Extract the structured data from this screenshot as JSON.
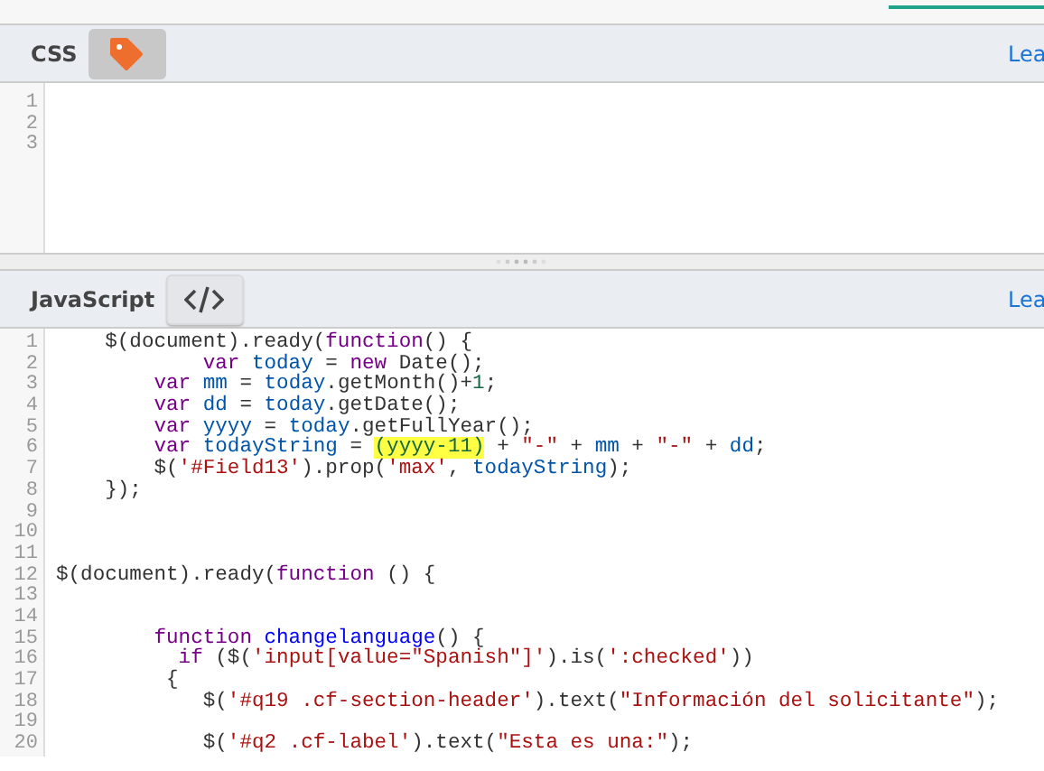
{
  "css_panel": {
    "title": "CSS",
    "link": "Lea",
    "line_numbers": [
      "1",
      "2",
      "3"
    ]
  },
  "js_panel": {
    "title": "JavaScript",
    "link": "Lea",
    "lines": [
      {
        "number": "1",
        "tokens": [
          {
            "kind": "plain",
            "text": "    $(document).ready("
          },
          {
            "kind": "keyword",
            "text": "function"
          },
          {
            "kind": "plain",
            "text": "() {"
          }
        ]
      },
      {
        "number": "2",
        "tokens": [
          {
            "kind": "keyword",
            "text": "            var "
          },
          {
            "kind": "variable",
            "text": "today"
          },
          {
            "kind": "plain",
            "text": " = "
          },
          {
            "kind": "keyword",
            "text": "new"
          },
          {
            "kind": "plain",
            "text": " Date();"
          }
        ]
      },
      {
        "number": "3",
        "tokens": [
          {
            "kind": "keyword",
            "text": "        var "
          },
          {
            "kind": "variable",
            "text": "mm"
          },
          {
            "kind": "plain",
            "text": " = "
          },
          {
            "kind": "variable",
            "text": "today"
          },
          {
            "kind": "plain",
            "text": ".getMonth()+"
          },
          {
            "kind": "number",
            "text": "1"
          },
          {
            "kind": "plain",
            "text": ";"
          }
        ]
      },
      {
        "number": "4",
        "tokens": [
          {
            "kind": "keyword",
            "text": "        var "
          },
          {
            "kind": "variable",
            "text": "dd"
          },
          {
            "kind": "plain",
            "text": " = "
          },
          {
            "kind": "variable",
            "text": "today"
          },
          {
            "kind": "plain",
            "text": ".getDate();"
          }
        ]
      },
      {
        "number": "5",
        "tokens": [
          {
            "kind": "keyword",
            "text": "        var "
          },
          {
            "kind": "variable",
            "text": "yyyy"
          },
          {
            "kind": "plain",
            "text": " = "
          },
          {
            "kind": "variable",
            "text": "today"
          },
          {
            "kind": "plain",
            "text": ".getFullYear();"
          }
        ]
      },
      {
        "number": "6",
        "tokens": [
          {
            "kind": "keyword",
            "text": "        var "
          },
          {
            "kind": "variable",
            "text": "todayString"
          },
          {
            "kind": "plain",
            "text": " = "
          },
          {
            "kind": "highlight",
            "text": "(yyyy-11)"
          },
          {
            "kind": "plain",
            "text": " + "
          },
          {
            "kind": "string",
            "text": "\"-\""
          },
          {
            "kind": "plain",
            "text": " + "
          },
          {
            "kind": "variable",
            "text": "mm"
          },
          {
            "kind": "plain",
            "text": " + "
          },
          {
            "kind": "string",
            "text": "\"-\""
          },
          {
            "kind": "plain",
            "text": " + "
          },
          {
            "kind": "variable",
            "text": "dd"
          },
          {
            "kind": "plain",
            "text": ";"
          }
        ]
      },
      {
        "number": "7",
        "tokens": [
          {
            "kind": "plain",
            "text": "        $("
          },
          {
            "kind": "string",
            "text": "'#Field13'"
          },
          {
            "kind": "plain",
            "text": ").prop("
          },
          {
            "kind": "string",
            "text": "'max'"
          },
          {
            "kind": "plain",
            "text": ", "
          },
          {
            "kind": "variable",
            "text": "todayString"
          },
          {
            "kind": "plain",
            "text": ");"
          }
        ]
      },
      {
        "number": "8",
        "tokens": [
          {
            "kind": "plain",
            "text": "    });"
          }
        ]
      },
      {
        "number": "9"
      },
      {
        "number": "10"
      },
      {
        "number": "11"
      },
      {
        "number": "12",
        "tokens": [
          {
            "kind": "plain",
            "text": "$(document).ready("
          },
          {
            "kind": "keyword",
            "text": "function"
          },
          {
            "kind": "plain",
            "text": " () {"
          }
        ]
      },
      {
        "number": "13"
      },
      {
        "number": "14"
      },
      {
        "number": "15",
        "tokens": [
          {
            "kind": "keyword",
            "text": "        function "
          },
          {
            "kind": "def",
            "text": "changelanguage"
          },
          {
            "kind": "plain",
            "text": "() {"
          }
        ]
      },
      {
        "number": "16",
        "tokens": [
          {
            "kind": "keyword",
            "text": "          if"
          },
          {
            "kind": "plain",
            "text": " ($("
          },
          {
            "kind": "string",
            "text": "'input[value=\"Spanish\"]'"
          },
          {
            "kind": "plain",
            "text": ").is("
          },
          {
            "kind": "string",
            "text": "':checked'"
          },
          {
            "kind": "plain",
            "text": "))"
          }
        ]
      },
      {
        "number": "17",
        "tokens": [
          {
            "kind": "plain",
            "text": "         {"
          }
        ]
      },
      {
        "number": "18",
        "tokens": [
          {
            "kind": "plain",
            "text": "            $("
          },
          {
            "kind": "string",
            "text": "'#q19 .cf-section-header'"
          },
          {
            "kind": "plain",
            "text": ").text("
          },
          {
            "kind": "string",
            "text": "\"Información del solicitante\""
          },
          {
            "kind": "plain",
            "text": ");"
          }
        ]
      },
      {
        "number": "19"
      },
      {
        "number": "20",
        "tokens": [
          {
            "kind": "plain",
            "text": "            $("
          },
          {
            "kind": "string",
            "text": "'#q2 .cf-label'"
          },
          {
            "kind": "plain",
            "text": ").text("
          },
          {
            "kind": "string",
            "text": "\"Esta es una:\""
          },
          {
            "kind": "plain",
            "text": ");"
          }
        ]
      }
    ]
  }
}
